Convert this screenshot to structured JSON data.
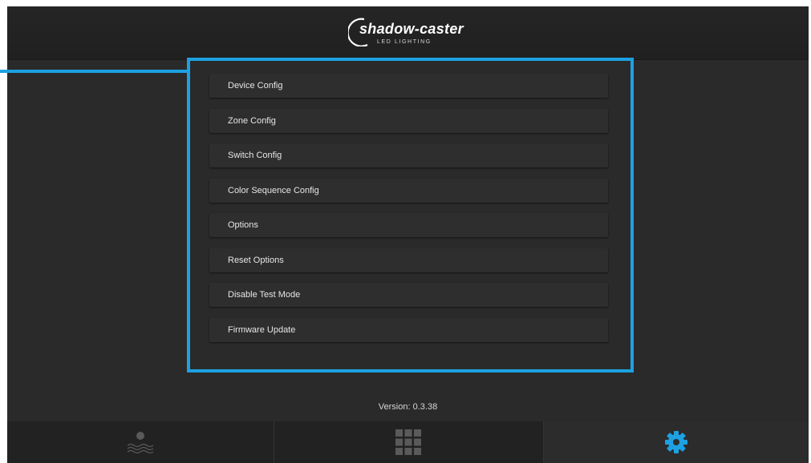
{
  "header": {
    "logo_main": "shadow-caster",
    "logo_sub": "LED LIGHTING"
  },
  "menu": {
    "items": [
      {
        "label": "Device Config"
      },
      {
        "label": "Zone Config"
      },
      {
        "label": "Switch Config"
      },
      {
        "label": "Color Sequence Config"
      },
      {
        "label": "Options"
      },
      {
        "label": "Reset Options"
      },
      {
        "label": "Disable Test Mode"
      },
      {
        "label": "Firmware Update"
      }
    ]
  },
  "footer": {
    "version": "Version: 0.3.38"
  },
  "bottom_nav": {
    "tabs": [
      {
        "icon": "water-light-icon",
        "active": false
      },
      {
        "icon": "grid-icon",
        "active": false
      },
      {
        "icon": "gear-icon",
        "active": true
      }
    ]
  },
  "colors": {
    "accent": "#1da1e2",
    "background": "#2a2a2a",
    "button": "#2e2e2e",
    "text": "#e6e6e6",
    "inactive_icon": "#5a5a5a"
  }
}
